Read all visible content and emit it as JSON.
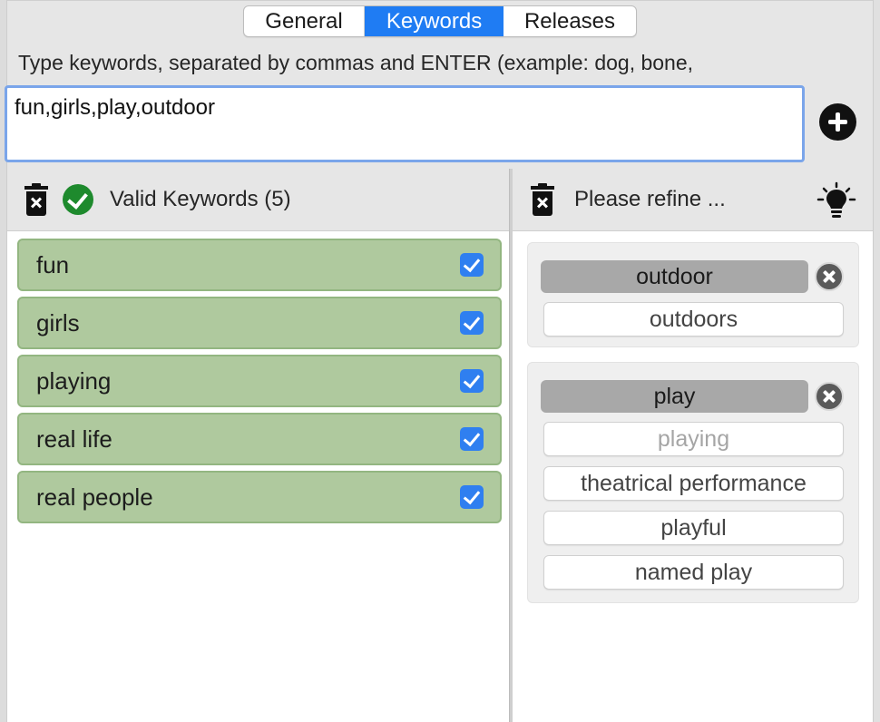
{
  "tabs": [
    {
      "label": "General",
      "active": false
    },
    {
      "label": "Keywords",
      "active": true
    },
    {
      "label": "Releases",
      "active": false
    }
  ],
  "instructions": "Type keywords, separated by commas and ENTER (example: dog, bone,",
  "keyword_input": {
    "value": "fun,girls,play,outdoor",
    "placeholder": ""
  },
  "valid_panel": {
    "title": "Valid Keywords (5)"
  },
  "refine_panel": {
    "title": "Please refine ..."
  },
  "valid_keywords": [
    {
      "label": "fun",
      "checked": true
    },
    {
      "label": "girls",
      "checked": true
    },
    {
      "label": "playing",
      "checked": true
    },
    {
      "label": "real life",
      "checked": true
    },
    {
      "label": "real people",
      "checked": true
    }
  ],
  "refine_groups": [
    {
      "keyword": "outdoor",
      "suggestions": [
        {
          "label": "outdoors",
          "disabled": false
        }
      ]
    },
    {
      "keyword": "play",
      "suggestions": [
        {
          "label": "playing",
          "disabled": true
        },
        {
          "label": "theatrical performance",
          "disabled": false
        },
        {
          "label": "playful",
          "disabled": false
        },
        {
          "label": "named play",
          "disabled": false
        }
      ]
    }
  ],
  "colors": {
    "accent": "#1f7cf3",
    "valid_item_bg": "#afc99e",
    "valid_check": "#1e8a2d",
    "checkbox": "#2f7ff0"
  },
  "icons": {
    "add": "plus-circle-icon",
    "delete": "trash-icon",
    "valid": "check-circle-icon",
    "suggest": "lightbulb-icon",
    "remove": "close-circle-icon"
  }
}
